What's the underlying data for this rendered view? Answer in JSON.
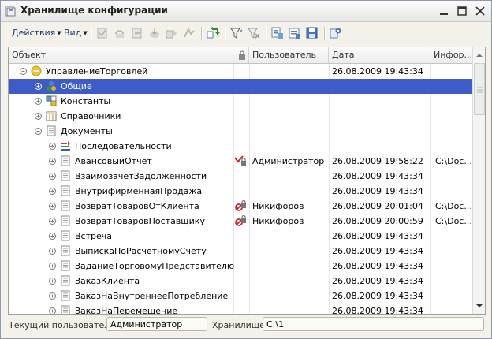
{
  "window": {
    "title": "Хранилище конфигурации",
    "icon": "app-config-icon",
    "controls": [
      "minimize-icon",
      "maximize-icon",
      "close-icon"
    ]
  },
  "toolbar": {
    "actions_menu": "Действия",
    "view_menu": "Вид",
    "buttons": [
      "capture-icon",
      "release-icon",
      "undo-capture-icon",
      "save-to-repo-icon",
      "get-from-repo-icon",
      "compare-icon",
      "refresh-icon",
      "filter-icon",
      "clear-filter-icon",
      "history-icon",
      "report-icon",
      "save-file-icon",
      "settings-icon"
    ]
  },
  "table": {
    "columns": {
      "object": "Объект",
      "lock": "lock-icon",
      "user": "Пользователь",
      "date": "Дата",
      "info": "Инфор..."
    },
    "rows": [
      {
        "label": "УправлениеТорговлей",
        "level": 0,
        "expander": "minus",
        "icon": "root-config-icon",
        "lock": "",
        "user": "",
        "date": "26.08.2009 19:43:34",
        "info": ""
      },
      {
        "label": "Общие",
        "level": 1,
        "expander": "plus",
        "icon": "common-icon",
        "lock": "",
        "user": "",
        "date": "",
        "info": "",
        "selected": true
      },
      {
        "label": "Константы",
        "level": 1,
        "expander": "plus",
        "icon": "constants-icon",
        "lock": "",
        "user": "",
        "date": "",
        "info": ""
      },
      {
        "label": "Справочники",
        "level": 1,
        "expander": "plus",
        "icon": "catalogs-icon",
        "lock": "",
        "user": "",
        "date": "",
        "info": ""
      },
      {
        "label": "Документы",
        "level": 1,
        "expander": "minus",
        "icon": "document-icon",
        "lock": "",
        "user": "",
        "date": "",
        "info": ""
      },
      {
        "label": "Последовательности",
        "level": 2,
        "expander": "plus",
        "icon": "sequences-icon",
        "lock": "",
        "user": "",
        "date": "",
        "info": ""
      },
      {
        "label": "АвансовыйОтчет",
        "level": 2,
        "expander": "plus",
        "icon": "document-icon",
        "lock": "captured-self-icon",
        "user": "Администратор",
        "date": "26.08.2009 19:58:22",
        "info": "C:\\Doc..."
      },
      {
        "label": "ВзаимозачетЗадолженности",
        "level": 2,
        "expander": "plus",
        "icon": "document-icon",
        "lock": "",
        "user": "",
        "date": "26.08.2009 19:43:34",
        "info": ""
      },
      {
        "label": "ВнутрифирменнаяПродажа",
        "level": 2,
        "expander": "plus",
        "icon": "document-icon",
        "lock": "",
        "user": "",
        "date": "26.08.2009 19:43:34",
        "info": ""
      },
      {
        "label": "ВозвратТоваровОтКлиента",
        "level": 2,
        "expander": "plus",
        "icon": "document-icon",
        "lock": "captured-other-icon",
        "user": "Никифоров",
        "date": "26.08.2009 20:01:04",
        "info": "C:\\Doc..."
      },
      {
        "label": "ВозвратТоваровПоставщику",
        "level": 2,
        "expander": "plus",
        "icon": "document-icon",
        "lock": "captured-other-icon",
        "user": "Никифоров",
        "date": "26.08.2009 20:00:59",
        "info": "C:\\Doc..."
      },
      {
        "label": "Встреча",
        "level": 2,
        "expander": "plus",
        "icon": "document-icon",
        "lock": "",
        "user": "",
        "date": "26.08.2009 19:43:34",
        "info": ""
      },
      {
        "label": "ВыпискаПоРасчетномуСчету",
        "level": 2,
        "expander": "plus",
        "icon": "document-icon",
        "lock": "",
        "user": "",
        "date": "26.08.2009 19:43:34",
        "info": ""
      },
      {
        "label": "ЗаданиеТорговомуПредставителю",
        "level": 2,
        "expander": "plus",
        "icon": "document-icon",
        "lock": "",
        "user": "",
        "date": "26.08.2009 19:43:34",
        "info": ""
      },
      {
        "label": "ЗаказКлиента",
        "level": 2,
        "expander": "plus",
        "icon": "document-icon",
        "lock": "",
        "user": "",
        "date": "26.08.2009 19:43:34",
        "info": ""
      },
      {
        "label": "ЗаказНаВнутреннееПотребление",
        "level": 2,
        "expander": "plus",
        "icon": "document-icon",
        "lock": "",
        "user": "",
        "date": "26.08.2009 19:43:34",
        "info": ""
      },
      {
        "label": "ЗаказНаПеремещение",
        "level": 2,
        "expander": "plus",
        "icon": "document-icon",
        "lock": "",
        "user": "",
        "date": "26.08.2009 19:43:34",
        "info": ""
      }
    ]
  },
  "status": {
    "user_label": "Текущий пользователь:",
    "user_value": "Администратор",
    "repo_label": "Хранилище:",
    "repo_value": "C:\\1"
  },
  "colors": {
    "selection": "#3d5cc8",
    "window_bg": "#f3f1ea",
    "captured_self": "#cc2222",
    "captured_other": "#cc2222"
  }
}
